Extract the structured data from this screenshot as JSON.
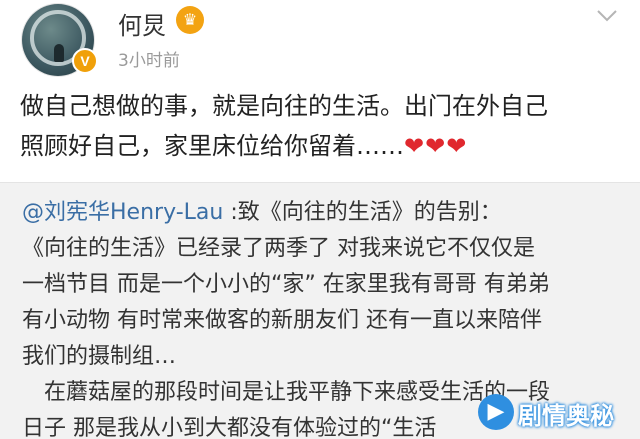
{
  "header": {
    "username": "何炅",
    "timestamp": "3小时前",
    "verified_badge": "V",
    "crown_icon": "crown-icon",
    "menu_icon": "chevron-down-icon"
  },
  "post": {
    "line1": "做自己想做的事，就是向往的生活。出门在外自己",
    "line2": "照顾好自己，家里床位给你留着……",
    "hearts": "❤❤❤"
  },
  "repost": {
    "mention": "@刘宪华Henry-Lau",
    "title_rest": " :致《向往的生活》的告别：",
    "lines": [
      "《向往的生活》已经录了两季了 对我来说它不仅仅是",
      "一档节目 而是一个小小的“家” 在家里我有哥哥 有弟弟",
      "有小动物 有时常来做客的新朋友们 还有一直以来陪伴",
      "我们的摄制组…",
      "　在蘑菇屋的那段时间是让我平静下来感受生活的一段",
      "日子 那是我从小到大都没有体验过的“生活"
    ]
  },
  "watermark": {
    "text": "剧情奥秘",
    "icon": "play-icon"
  },
  "colors": {
    "mention": "#3a6ea5",
    "heart": "#e0282e",
    "badge": "#f0a00a",
    "repost_bg": "#f2f2f2"
  }
}
